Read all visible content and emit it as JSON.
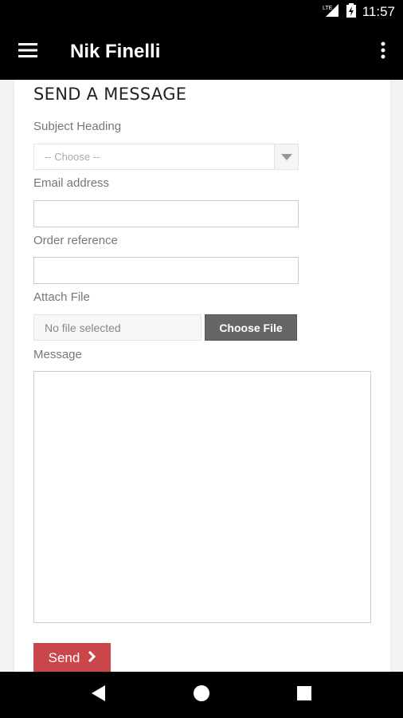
{
  "status_bar": {
    "network_label": "LTE",
    "time": "11:57"
  },
  "app_bar": {
    "title": "Nik Finelli"
  },
  "form": {
    "title": "SEND A MESSAGE",
    "subject_label": "Subject Heading",
    "subject_value": "-- Choose --",
    "email_label": "Email address",
    "email_value": "",
    "order_label": "Order reference",
    "order_value": "",
    "attach_label": "Attach File",
    "file_status": "No file selected",
    "choose_file_label": "Choose File",
    "message_label": "Message",
    "message_value": "",
    "send_label": "Send"
  },
  "colors": {
    "send_button": "#c9464a",
    "app_bar": "#000000",
    "choose_button": "#666666"
  }
}
